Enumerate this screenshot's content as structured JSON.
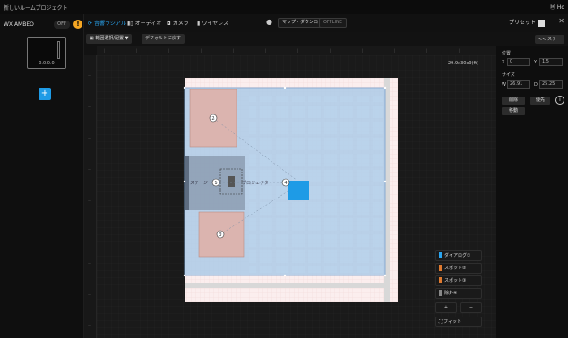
{
  "window": {
    "title": "新しいルームプロジェクト",
    "logo": "Ⓜ Ho"
  },
  "left": {
    "model": "WX AMBEO",
    "model_pill": "OFF",
    "warn": "!",
    "version": "0.0.0.0",
    "add": "+"
  },
  "tabs": [
    {
      "label": "音響ラジアル",
      "icon": "⟳",
      "active": true
    },
    {
      "label": "オーディオ",
      "icon": "▮▯",
      "active": false
    },
    {
      "label": "カメラ",
      "icon": "◘",
      "active": false
    },
    {
      "label": "ワイヤレス",
      "icon": "▮",
      "active": false
    }
  ],
  "mic_icon": "●",
  "mode_buttons": {
    "active": "マップ・ダウンロ",
    "offline": "OFFLINE"
  },
  "preset": {
    "label": "プリセット",
    "close": "✕"
  },
  "toolbar": {
    "area_select": "▣ 範囲選択/配置 ▼",
    "default_btn": "デフォルトに戻す",
    "collapse": "<< ステー"
  },
  "dimension_label": "29.9x30x9(ft)",
  "props": {
    "position_label": "位置",
    "x_label": "X",
    "x_value": "0",
    "y_label": "Y",
    "y_value": "1.5",
    "size_label": "サイズ",
    "w_label": "W",
    "w_value": "26.91",
    "d_label": "D",
    "d_value": "25.25",
    "btn_delete": "削除",
    "btn_priority": "優先",
    "btn_move": "移動",
    "info": "i"
  },
  "zones": {
    "z1": "1",
    "z2": "2",
    "z3": "3",
    "z4": "4"
  },
  "labels": {
    "stage": "ステージ",
    "projector": "プロジェクター"
  },
  "side_buttons": [
    {
      "label": "ダイアログ①",
      "color": "#2aa5f0"
    },
    {
      "label": "スポット②",
      "color": "#e07a2f"
    },
    {
      "label": "スポット③",
      "color": "#e07a2f"
    },
    {
      "label": "除外④",
      "color": "#888888"
    }
  ],
  "zoom": {
    "plus": "+",
    "minus": "−",
    "fit": "⛶ フィット"
  },
  "colors": {
    "accent": "#1e9be6",
    "room_fill": "#aecbe8",
    "pink": "#f0b5ae"
  }
}
